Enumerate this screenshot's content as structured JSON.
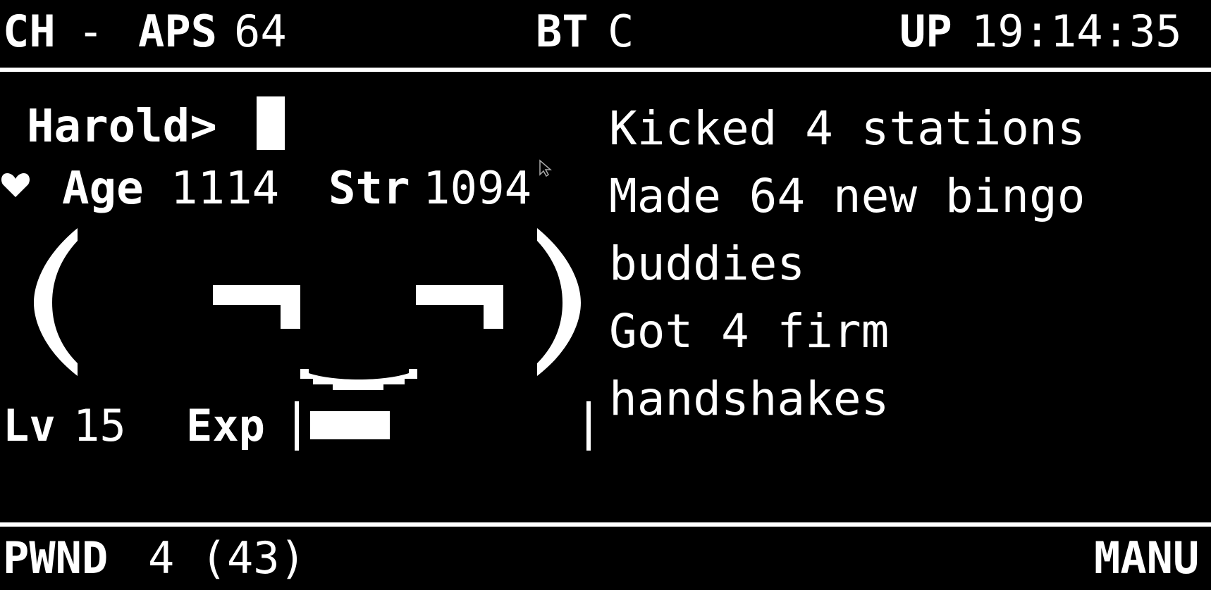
{
  "colors": {
    "background": "#000000",
    "foreground": "#ffffff"
  },
  "top_bar": {
    "channel_label": "CH",
    "channel_value": "-",
    "aps_label": "APS",
    "aps_value": "64",
    "bt_label": "BT",
    "bt_value": "C",
    "uptime_label": "UP",
    "uptime_value": "19:14:35"
  },
  "main": {
    "prompt_name": "Harold>",
    "heart_icon": "heart-icon",
    "age_label": "Age",
    "age_value": "1114",
    "str_label": "Str",
    "str_value": "1094",
    "face": {
      "left_bracket": "(",
      "right_bracket": ")"
    },
    "level_label": "Lv",
    "level_value": "15",
    "exp_label": "Exp",
    "exp_fraction": 0.3
  },
  "status_text": {
    "line1": "Kicked 4 stations",
    "line2": "Made 64 new bingo",
    "line3": "buddies",
    "line4": "Got 4 firm",
    "line5": "handshakes"
  },
  "bottom_bar": {
    "pwnd_label": "PWND",
    "pwnd_value": "4 (43)",
    "mode": "MANU"
  }
}
